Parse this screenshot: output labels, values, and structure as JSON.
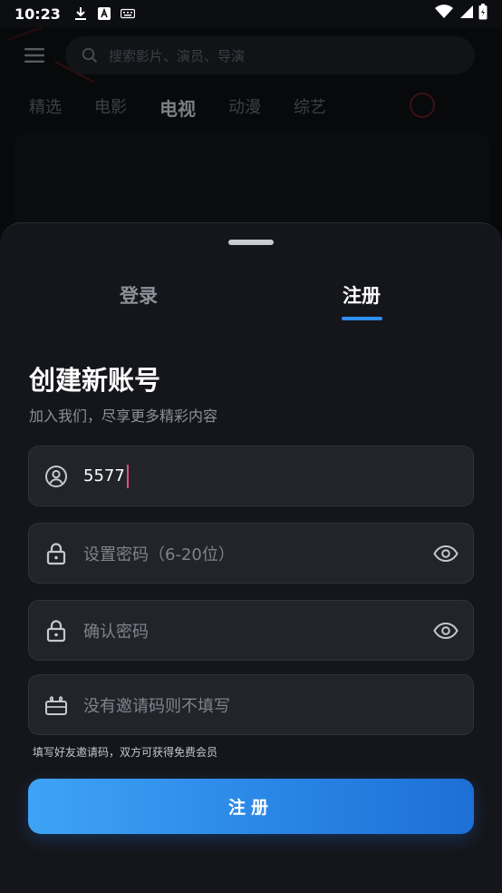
{
  "status_bar": {
    "time": "10:23"
  },
  "header": {
    "search_placeholder": "搜索影片、演员、导演",
    "tabs": [
      {
        "label": "精选"
      },
      {
        "label": "电影"
      },
      {
        "label": "电视"
      },
      {
        "label": "动漫"
      },
      {
        "label": "综艺"
      }
    ]
  },
  "auth_sheet": {
    "tabs": {
      "login": "登录",
      "register": "注册"
    },
    "title": "创建新账号",
    "subtitle": "加入我们，尽享更多精彩内容",
    "username_value": "5577",
    "password_placeholder": "设置密码（6-20位）",
    "confirm_placeholder": "确认密码",
    "invite_placeholder": "没有邀请码则不填写",
    "invite_hint": "填写好友邀请码，双方可获得免费会员",
    "submit_label": "注册"
  },
  "colors": {
    "accent": "#2f8ff0",
    "caret": "#e0507a",
    "sheet": "#15161b"
  }
}
